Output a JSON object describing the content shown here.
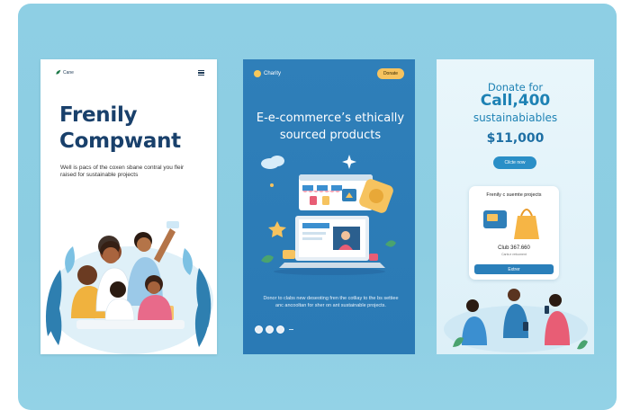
{
  "cards": [
    {
      "logo_text": "Cane",
      "title": "Frenily Compwant",
      "description": "Well is pacs of the coxen sbane contral you fleir raised for sustainable projects"
    },
    {
      "logo_text": "Charity",
      "button_label": "Donate",
      "title": "E-e-commerce’s ethically sourced products",
      "description": "Donor to clabs new deseoting fren the cotliay to the bs settiee anc ancooltan for sher on ant sustainable projects.",
      "dash": "—"
    },
    {
      "heading_line1": "Donate for",
      "heading_line2": "Call,400",
      "heading_line3": "sustainabiables",
      "amount": "$11,000",
      "button_label": "Cilcte now",
      "panel": {
        "title": "Frenily c suemte projects",
        "amount": "Club 367.660",
        "subtext": "Carts e refcoment",
        "button_label": "Extrer"
      }
    }
  ],
  "colors": {
    "background": "#8ecfe4",
    "navy": "#19406b",
    "blue": "#2f7fb9",
    "accent_yellow": "#f6c35f",
    "light_blue_text": "#1e82b4"
  },
  "icons": [
    "menu-icon",
    "cloud-icon",
    "sparkle-icon",
    "star-icon",
    "laptop-icon",
    "shopping-bag-icon",
    "card-icon"
  ]
}
